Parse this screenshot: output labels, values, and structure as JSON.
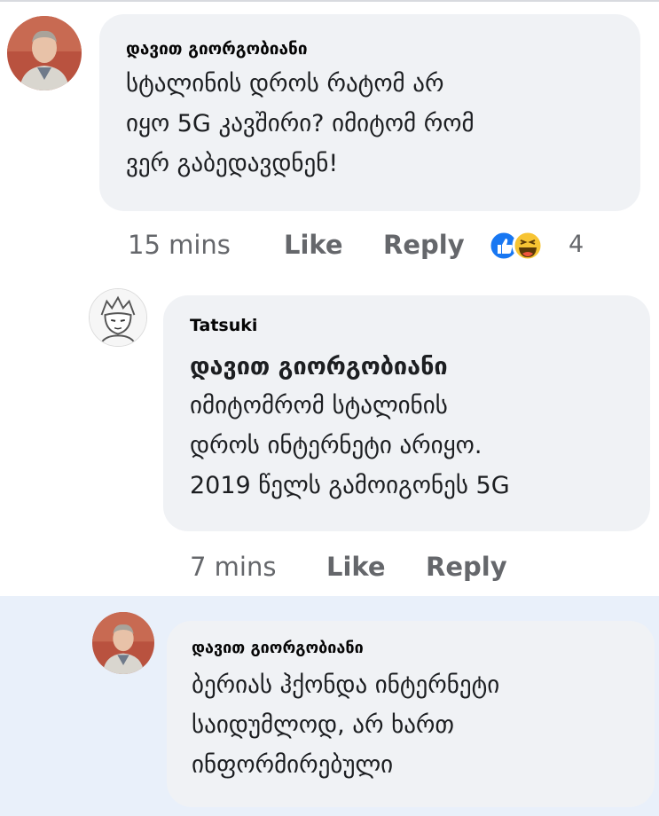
{
  "thread": {
    "comment1": {
      "author": "დავით გიორგობიანი",
      "lines": [
        "სტალინის დროს რატომ არ",
        "იყო 5G კავშირი? იმიტომ რომ",
        "ვერ გაბედავდნენ!"
      ],
      "time": "15 mins",
      "like_label": "Like",
      "reply_label": "Reply",
      "reactions": [
        "like-reaction-icon",
        "haha-reaction-icon"
      ],
      "reaction_count": "4"
    },
    "reply1": {
      "author": "Tatsuki",
      "mention": "დავით გიორგობიანი",
      "lines": [
        "იმიტომრომ სტალინის",
        "დროს ინტერნეტი არიყო.",
        "2019 წელს გამოიგონეს 5G"
      ],
      "time": "7 mins",
      "like_label": "Like",
      "reply_label": "Reply"
    },
    "reply2": {
      "author": "დავით გიორგობიანი",
      "lines": [
        "ბერიას ჰქონდა ინტერნეტი",
        "საიდუმლოდ, არ ხართ",
        "ინფორმირებული"
      ]
    }
  },
  "colors": {
    "bubble": "#f0f2f5",
    "meta_text": "#65676b",
    "highlight": "#e9f0fa",
    "like_blue": "#1877f2",
    "haha_yellow": "#f7c433"
  }
}
